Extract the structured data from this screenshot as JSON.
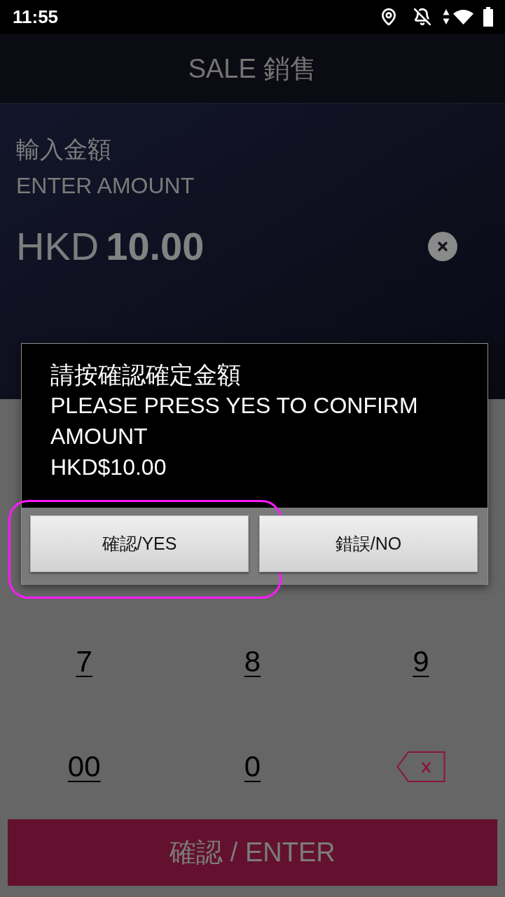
{
  "status_bar": {
    "time": "11:55"
  },
  "header": {
    "title": "SALE 銷售"
  },
  "amount_entry": {
    "label_zh": "輸入金額",
    "label_en": "ENTER AMOUNT",
    "currency": "HKD",
    "value": "10.00"
  },
  "keypad": {
    "rows": [
      [
        {
          "kind": "digit",
          "label": "7"
        },
        {
          "kind": "digit",
          "label": "8"
        },
        {
          "kind": "digit",
          "label": "9"
        }
      ],
      [
        {
          "kind": "digit",
          "label": "00"
        },
        {
          "kind": "digit",
          "label": "0"
        },
        {
          "kind": "backspace"
        }
      ]
    ]
  },
  "enter_button": {
    "label": "確認 / ENTER"
  },
  "dialog": {
    "message_zh": "請按確認確定金額",
    "message_en": "PLEASE PRESS YES TO CONFIRM AMOUNT",
    "amount": "HKD$10.00",
    "buttons": [
      {
        "label": "確認/YES",
        "highlighted": true
      },
      {
        "label": "錯誤/NO",
        "highlighted": false
      }
    ]
  }
}
